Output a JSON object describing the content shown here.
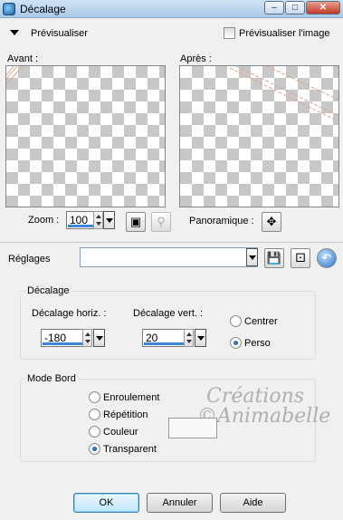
{
  "window": {
    "title": "Décalage",
    "minimize_icon": "minimize-icon",
    "maximize_icon": "maximize-icon",
    "close_icon": "close-icon"
  },
  "preview": {
    "toggle_label": "Prévisualiser",
    "preview_on_image_label": "Prévisualiser l'image",
    "before_label": "Avant :",
    "after_label": "Après :",
    "zoom_label": "Zoom :",
    "zoom_value": "100",
    "pan_label": "Panoramique :"
  },
  "presets": {
    "label": "Réglages",
    "value": ""
  },
  "offset": {
    "group_title": "Décalage",
    "horiz_label": "Décalage horiz. :",
    "horiz_value": "-180",
    "vert_label": "Décalage vert. :",
    "vert_value": "20",
    "options": [
      {
        "label": "Centrer",
        "checked": false
      },
      {
        "label": "Perso",
        "checked": true
      }
    ]
  },
  "edge_mode": {
    "group_title": "Mode Bord",
    "options": [
      {
        "label": "Enroulement",
        "checked": false
      },
      {
        "label": "Répétition",
        "checked": false
      },
      {
        "label": "Couleur",
        "checked": false
      },
      {
        "label": "Transparent",
        "checked": true
      }
    ]
  },
  "watermark": {
    "line1": "Créations",
    "line2": "©Animabelle"
  },
  "buttons": {
    "ok": "OK",
    "cancel": "Annuler",
    "help": "Aide"
  },
  "colors": {
    "accent": "#3b87d8",
    "checker": "#c8c8c8",
    "preview_stroke": "#d9a98a"
  }
}
